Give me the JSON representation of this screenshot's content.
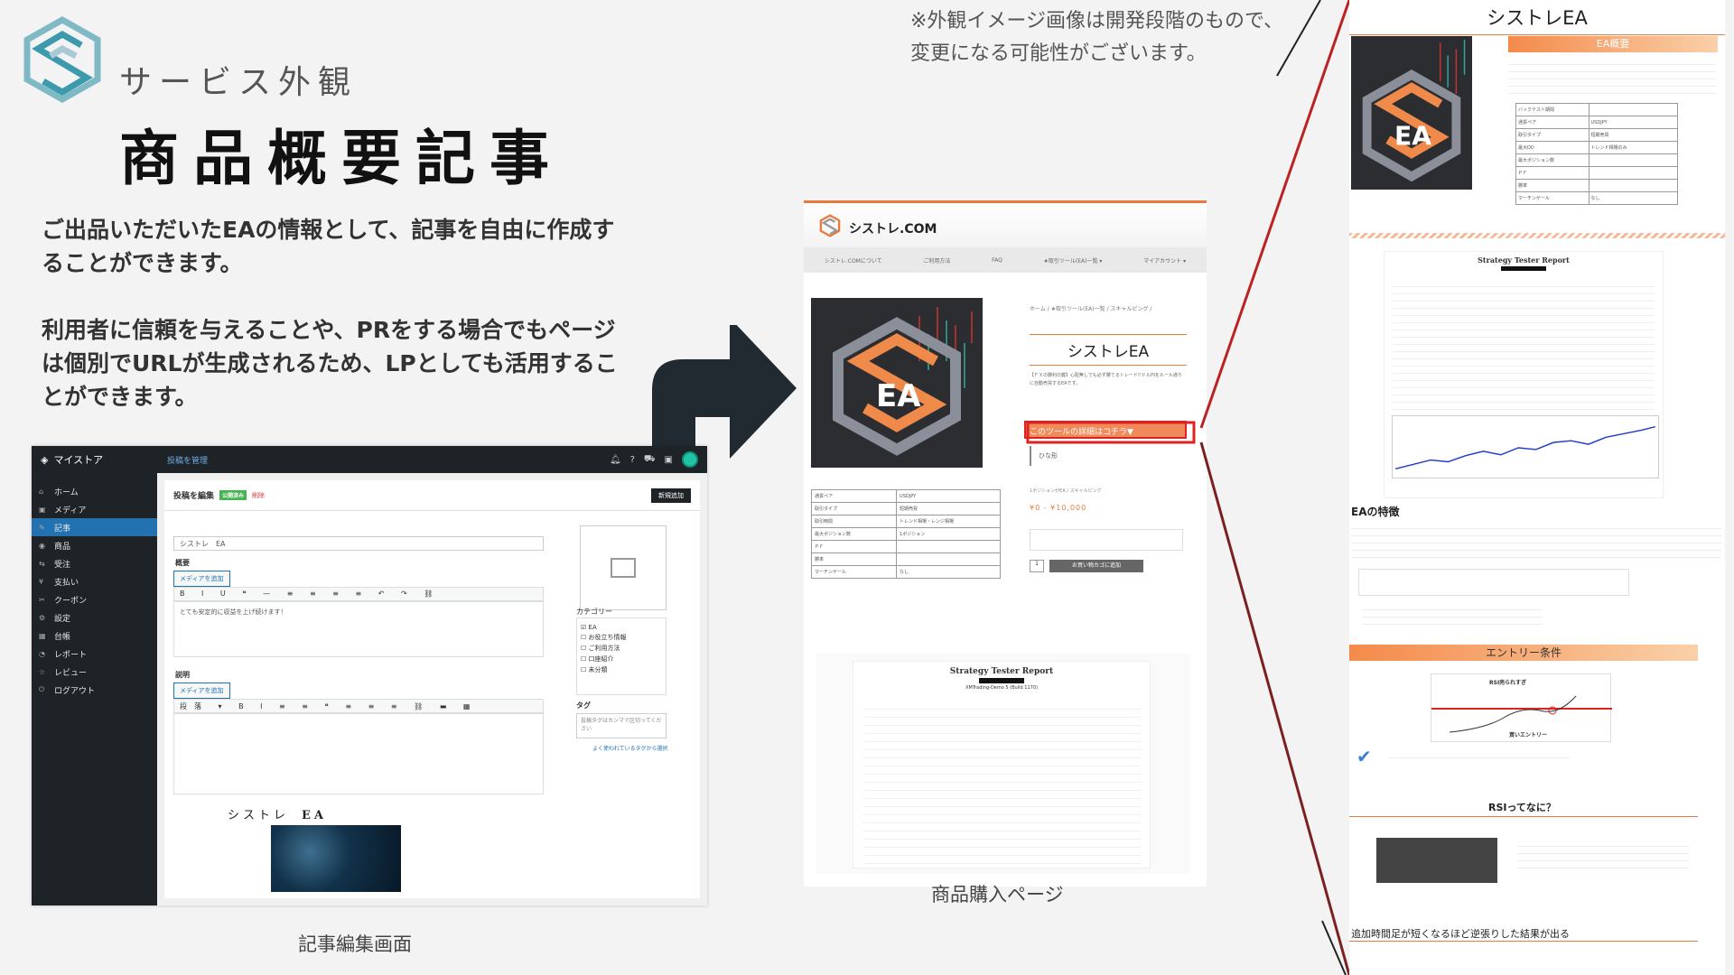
{
  "header": {
    "service_label": "サービス外観",
    "page_title": "商品概要記事",
    "description_1": "ご出品いただいたEAの情報として、記事を自由に作成することができます。",
    "description_2": "利用者に信頼を与えることや、PRをする場合でもページは個別でURLが生成されるため、LPとしても活用することができます。",
    "disclaimer_line1": "※外観イメージ画像は開発段階のもので、",
    "disclaimer_line2": "変更になる可能性がございます。"
  },
  "captions": {
    "editor": "記事編集画面",
    "purchase": "商品購入ページ"
  },
  "admin": {
    "brand": "マイストア",
    "breadcrumb": "投稿を管理",
    "page_heading": "投稿を編集",
    "status_badge": "公開済み",
    "delete_label": "削除",
    "new_button": "新規追加",
    "title_value": "シストレ　EA",
    "overview_label": "概要",
    "description_label": "説明",
    "media_button": "メディアを追加",
    "editor_text": "とても安定的に収益を上げ続けます！",
    "format_select": "段落",
    "category_label": "カテゴリー",
    "categories": [
      "EA",
      "お役立ち情報",
      "ご利用方法",
      "口座紹介",
      "未分類"
    ],
    "tag_label": "タグ",
    "tag_placeholder": "投稿タグはカンマで区切ってください",
    "tag_link": "よく使われているタグから選択",
    "preview_title": "シストレ",
    "preview_title_b": "EA",
    "sidebar": [
      {
        "icon": "⌂",
        "label": "ホーム"
      },
      {
        "icon": "▣",
        "label": "メディア"
      },
      {
        "icon": "✎",
        "label": "記事"
      },
      {
        "icon": "◉",
        "label": "商品"
      },
      {
        "icon": "⇆",
        "label": "受注"
      },
      {
        "icon": "¥",
        "label": "支払い"
      },
      {
        "icon": "✂",
        "label": "クーポン"
      },
      {
        "icon": "⚙",
        "label": "設定"
      },
      {
        "icon": "▦",
        "label": "台帳"
      },
      {
        "icon": "◔",
        "label": "レポート"
      },
      {
        "icon": "☆",
        "label": "レビュー"
      },
      {
        "icon": "⏻",
        "label": "ログアウト"
      }
    ]
  },
  "product": {
    "site_name": "シストレ.COM",
    "nav": [
      "シストレ.COMについて",
      "ご利用方法",
      "FAQ",
      "★取引ツール(EA)一覧 ▾",
      "マイアカウント ▾"
    ],
    "breadcrumb": "ホーム / ★取引ツール(EA)一覧 / スキャルピング /",
    "name": "シストレEA",
    "desc": "【ＦＸの勝利の鍵】心配無しでも必ず勝てるトレード!!ドル円をルール通りに自動売買するEAです。",
    "detail_button": "このツールの詳細はコチラ▼",
    "hina": "ひな形",
    "category_line": "1ポジションがEA / スキャルピング",
    "price": "¥0 - ¥10,000",
    "cart_button": "お買い物カゴに追加",
    "qty": "1",
    "spec": [
      [
        "通貨ペア",
        "USDJPY"
      ],
      [
        "取引タイプ",
        "短期売買"
      ],
      [
        "取引時間",
        "トレンド相場・レンジ相場"
      ],
      [
        "最大ポジション数",
        "1ポジション"
      ],
      [
        "ＰＦ",
        ""
      ],
      [
        "勝率",
        ""
      ],
      [
        "マーチンゲール",
        "なし"
      ]
    ],
    "report_title": "Strategy Tester Report",
    "report_sub": "XMTrading-Demo 5 (Build 1170)"
  },
  "right": {
    "title": "シストレEA",
    "overview_head": "EA概要",
    "report_title": "Strategy Tester Report",
    "features": "EAの特徴",
    "entry": "エントリー条件",
    "rsi_label": "RSI売られすぎ",
    "rsi_buy": "買いエントリー",
    "rsi_q": "RSIってなに？",
    "bottom": "追加時間足が短くなるほど逆張りした結果が出る",
    "spec": [
      [
        "バックテスト期間",
        ""
      ],
      [
        "通貨ペア",
        "USDJPY"
      ],
      [
        "取引タイプ",
        "短期売買"
      ],
      [
        "最大DD",
        "トレンド相場のみ"
      ],
      [
        "最大ポジション数",
        ""
      ],
      [
        "ＰＦ",
        ""
      ],
      [
        "勝率",
        ""
      ],
      [
        "マーチンゲール",
        "なし"
      ]
    ]
  },
  "colors": {
    "accent": "#e87b3c",
    "dark": "#1d2327",
    "wp_blue": "#2271b1",
    "highlight": "#d22222"
  }
}
